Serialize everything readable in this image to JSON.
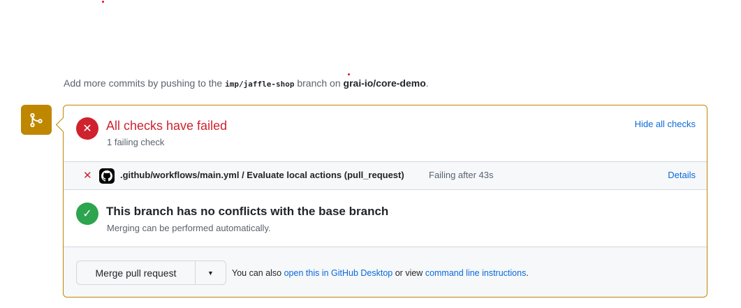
{
  "hint": {
    "prefix": "Add more commits by pushing to the",
    "branch": "imp/jaffle-shop",
    "middle": "branch on",
    "repo": "grai-io/core-demo",
    "suffix": "."
  },
  "checks": {
    "title": "All checks have failed",
    "subtitle": "1 failing check",
    "toggle": "Hide all checks",
    "status_color": "#cf222e"
  },
  "check_row": {
    "name": ".github/workflows/main.yml / Evaluate local actions (pull_request)",
    "status": "Failing after 43s",
    "details": "Details"
  },
  "conflicts": {
    "title": "This branch has no conflicts with the base branch",
    "subtitle": "Merging can be performed automatically.",
    "status_color": "#2da44e"
  },
  "merge": {
    "button": "Merge pull request",
    "text_prefix": "You can also",
    "desktop_link": "open this in GitHub Desktop",
    "text_middle": "or view",
    "cli_link": "command line instructions",
    "text_suffix": "."
  },
  "accent": "#bf8700"
}
